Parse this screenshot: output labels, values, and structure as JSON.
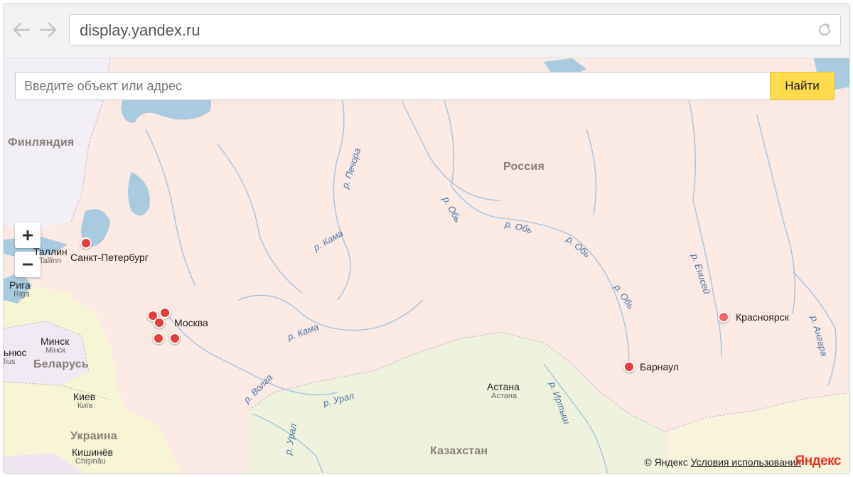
{
  "browser": {
    "url": "display.yandex.ru",
    "back_icon": "arrow-left-icon",
    "forward_icon": "arrow-right-icon",
    "reload_icon": "reload-icon"
  },
  "search": {
    "placeholder": "Введите объект или адрес",
    "button_label": "Найти",
    "button_color": "#ffdb4d"
  },
  "zoom": {
    "in_label": "+",
    "out_label": "−"
  },
  "countries": {
    "finland": "Финляндия",
    "russia": "Россия",
    "belarus": "Беларусь",
    "ukraine": "Украина",
    "kazakhstan": "Казахстан"
  },
  "cities": {
    "tallinn": "Таллин",
    "tallinn_local": "Tallinn",
    "riga": "Рига",
    "riga_local": "Riga",
    "minsk": "Минск",
    "minsk_local": "Мінск",
    "vilnius_part": "ьнюс",
    "vilnius_local_part": "lius",
    "kyiv": "Киев",
    "kyiv_local": "Київ",
    "chisinau": "Кишинёв",
    "chisinau_local": "Chişinău",
    "astana": "Астана",
    "astana_local": "Астана"
  },
  "markers": {
    "spb": "Санкт-Петербург",
    "moscow": "Москва",
    "barnaul": "Барнаул",
    "krasnoyarsk": "Красноярск",
    "marker_color": "#ea3c3c"
  },
  "rivers": {
    "pechora": "р. Печора",
    "ob1": "р. Обь",
    "ob2": "р. Обь",
    "ob3": "р. Обь",
    "ob4": "р. Обь",
    "kama1": "р. Кама",
    "kama2": "р. Кама",
    "volga": "р. Волга",
    "ural1": "р. Урал",
    "ural2": "р. Урал",
    "irtysh": "р. Иртыш",
    "yenisei": "р. Енисей",
    "angara": "р. Ангара"
  },
  "footer": {
    "copyright": "© Яндекс",
    "terms_link": "Условия использования",
    "logo": "Яндекс"
  }
}
